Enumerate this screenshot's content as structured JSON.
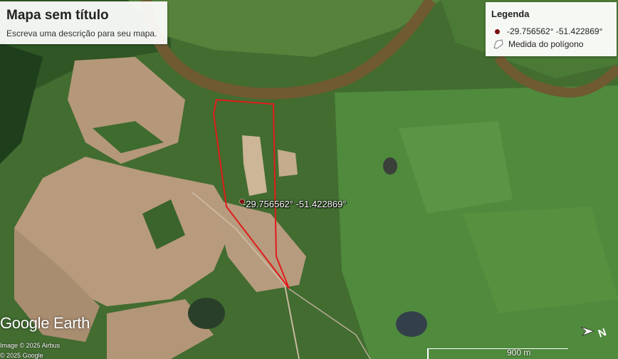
{
  "map_title": "Mapa sem título",
  "map_description": "Escreva uma descrição para seu mapa.",
  "legend": {
    "heading": "Legenda",
    "items": [
      {
        "label": "-29.756562° -51.422869°",
        "icon": "red-dot-icon"
      },
      {
        "label": "Medida do polígono",
        "icon": "polygon-icon"
      }
    ]
  },
  "placemark_label": "-29.756562° -51.422869°",
  "brand": "Google Earth",
  "credits": [
    "Image © 2025 Airbus",
    "© 2025 Google"
  ],
  "scale_label": "900 m",
  "compass_letter": "N",
  "colors": {
    "polygon_stroke": "#e01b1b",
    "placemark": "#7a1010",
    "river": "#6f5a32"
  }
}
